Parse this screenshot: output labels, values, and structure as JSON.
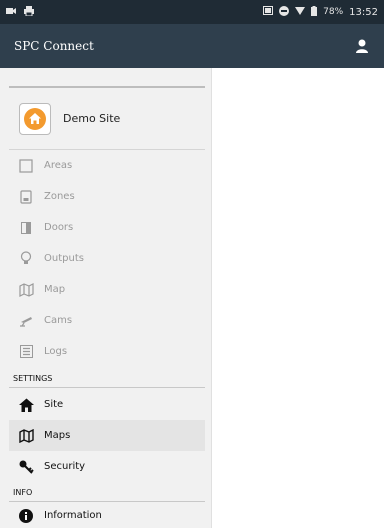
{
  "status": {
    "battery": "78%",
    "time": "13:52"
  },
  "app": {
    "title": "SPC Connect"
  },
  "site": {
    "name": "Demo Site"
  },
  "menu": [
    {
      "label": "Areas",
      "icon": "square-outline-icon"
    },
    {
      "label": "Zones",
      "icon": "zone-icon"
    },
    {
      "label": "Doors",
      "icon": "door-icon"
    },
    {
      "label": "Outputs",
      "icon": "lightbulb-icon"
    },
    {
      "label": "Map",
      "icon": "map-icon"
    },
    {
      "label": "Cams",
      "icon": "camera-icon"
    },
    {
      "label": "Logs",
      "icon": "list-icon"
    }
  ],
  "settings": {
    "header": "SETTINGS",
    "items": [
      {
        "label": "Site",
        "icon": "home-icon"
      },
      {
        "label": "Maps",
        "icon": "map-icon"
      },
      {
        "label": "Security",
        "icon": "key-icon"
      }
    ]
  },
  "info": {
    "header": "INFO",
    "items": [
      {
        "label": "Information",
        "icon": "info-icon"
      }
    ]
  },
  "colors": {
    "statusbar": "#1f2b35",
    "appbar": "#2f3f4d",
    "accent": "#f39a2e",
    "disabled_text": "#9a9a9a"
  }
}
